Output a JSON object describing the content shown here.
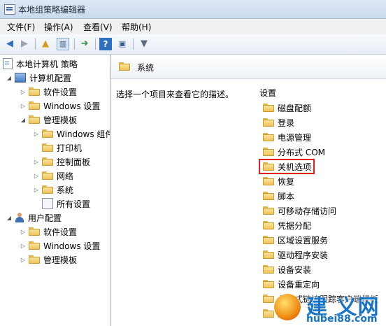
{
  "window": {
    "title": "本地组策略编辑器"
  },
  "menu": [
    "文件(F)",
    "操作(A)",
    "查看(V)",
    "帮助(H)"
  ],
  "toolbar": {
    "icons": [
      "back-arrow-icon",
      "forward-arrow-icon",
      "up-folder-icon",
      "show-hide-tree-icon",
      "export-list-icon",
      "help-icon",
      "action-pane-icon",
      "filter-icon"
    ]
  },
  "tree": {
    "root": "本地计算机 策略",
    "computer": "计算机配置",
    "c_software": "软件设置",
    "c_windows": "Windows 设置",
    "c_admin": "管理模板",
    "a_windows": "Windows 组件",
    "a_printer": "打印机",
    "a_control": "控制面板",
    "a_network": "网络",
    "a_system": "系统",
    "a_all": "所有设置",
    "user": "用户配置",
    "u_software": "软件设置",
    "u_windows": "Windows 设置",
    "u_admin": "管理模板"
  },
  "main": {
    "header": "系统",
    "description": "选择一个项目来查看它的描述。",
    "list_header": "设置",
    "items": [
      "磁盘配额",
      "登录",
      "电源管理",
      "分布式 COM",
      "关机选项",
      "恢复",
      "脚本",
      "可移动存储访问",
      "凭据分配",
      "区域设置服务",
      "驱动程序安装",
      "设备安装",
      "设备重定向",
      "分布式链接跟踪客户端模板",
      "服务"
    ]
  },
  "watermark": {
    "line1": "建  义网",
    "line2": "hubei88.com"
  }
}
